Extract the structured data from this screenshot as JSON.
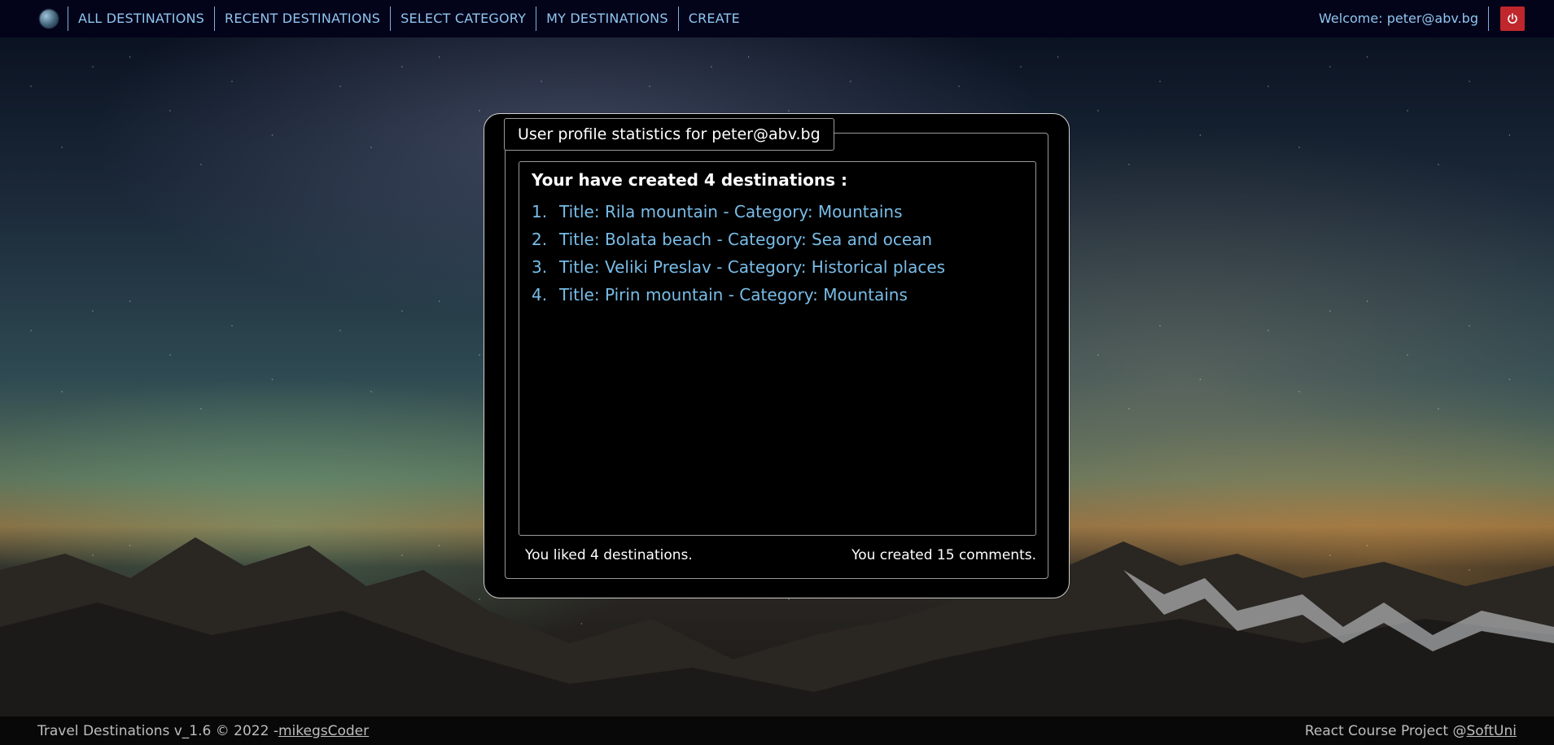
{
  "nav": {
    "items": [
      {
        "label": "ALL DESTINATIONS"
      },
      {
        "label": "RECENT DESTINATIONS"
      },
      {
        "label": "SELECT CATEGORY"
      },
      {
        "label": "MY DESTINATIONS"
      },
      {
        "label": "CREATE"
      }
    ],
    "welcome": "Welcome: peter@abv.bg",
    "logo_icon": "globe-icon",
    "logout_icon": "power-icon"
  },
  "profile": {
    "legend": "User profile statistics for peter@abv.bg",
    "created_heading": "Your have created 4 destinations :",
    "destinations": [
      {
        "num": "1.",
        "text": "Title: Rila mountain - Category: Mountains"
      },
      {
        "num": "2.",
        "text": "Title: Bolata beach - Category: Sea and ocean"
      },
      {
        "num": "3.",
        "text": "Title: Veliki Preslav - Category: Historical places"
      },
      {
        "num": "4.",
        "text": "Title: Pirin mountain - Category: Mountains"
      }
    ],
    "liked": "You liked 4 destinations.",
    "comments": "You created 15 comments."
  },
  "footer": {
    "left_text": "Travel Destinations v_1.6 © 2022 -",
    "left_link": "mikegsCoder",
    "right_text": "React Course Project @",
    "right_link": "SoftUni"
  },
  "colors": {
    "nav_bg": "#03031a",
    "nav_link": "#8fc6ef",
    "list_link": "#79bde8",
    "logout_bg": "#c0272d"
  }
}
